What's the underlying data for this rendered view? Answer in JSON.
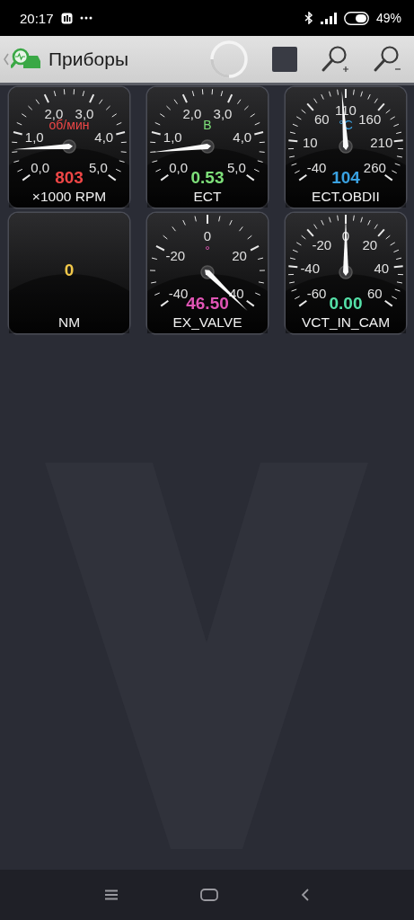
{
  "status_bar": {
    "time": "20:17",
    "battery": "49%"
  },
  "toolbar": {
    "title": "Приборы"
  },
  "gauges": [
    {
      "kind": "dial",
      "scale": [
        "2,0",
        "3,0",
        "1,0",
        "4,0",
        "0,0",
        "5,0"
      ],
      "unit": "об/мин",
      "reading": "803",
      "caption": "×1000 RPM",
      "color": "#ee4646"
    },
    {
      "kind": "dial",
      "scale": [
        "2,0",
        "3,0",
        "1,0",
        "4,0",
        "0,0",
        "5,0"
      ],
      "unit": "В",
      "reading": "0.53",
      "caption": "ECT",
      "color": "#7ee07a"
    },
    {
      "kind": "dial",
      "scale": [
        "60",
        "110",
        "160",
        "10",
        "210",
        "-40",
        "260"
      ],
      "unit": "°C",
      "reading": "104",
      "caption": "ECT.OBDII",
      "color": "#3aa2e2"
    },
    {
      "kind": "digital",
      "reading": "0",
      "caption": "NM",
      "color": "#f2c84a"
    },
    {
      "kind": "dial",
      "scale": [
        "0",
        "-20",
        "20",
        "-40",
        "40"
      ],
      "unit": "°",
      "reading": "46.50",
      "caption": "EX_VALVE",
      "color": "#e055b5"
    },
    {
      "kind": "dial",
      "scale": [
        "-20",
        "0",
        "20",
        "-40",
        "40",
        "-60",
        "60"
      ],
      "reading": "0.00",
      "caption": "VCT_IN_CAM",
      "color": "#55e0a8"
    }
  ]
}
